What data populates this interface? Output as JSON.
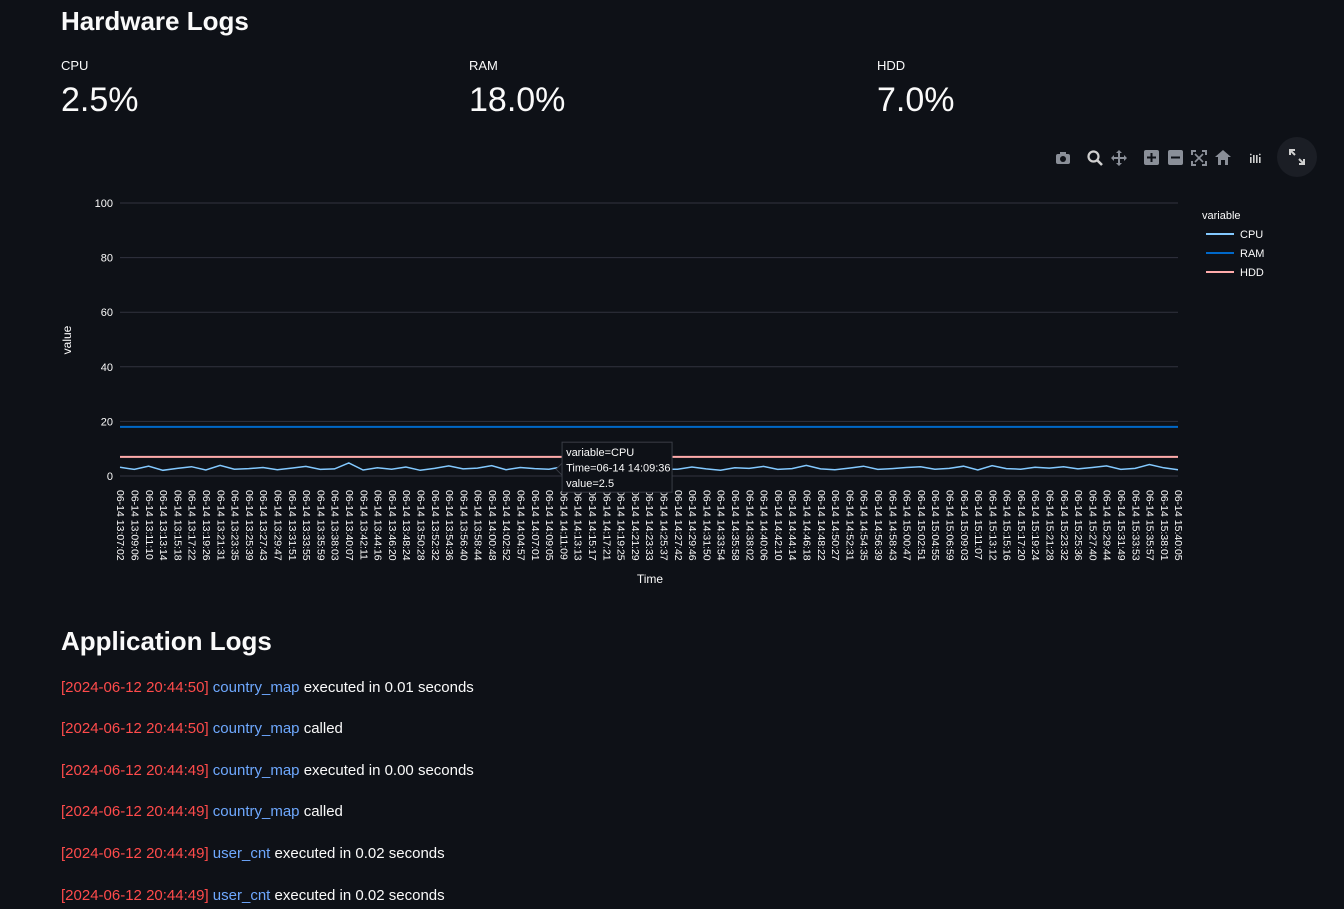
{
  "hardware": {
    "title": "Hardware Logs",
    "metrics": [
      {
        "label": "CPU",
        "value": "2.5%"
      },
      {
        "label": "RAM",
        "value": "18.0%"
      },
      {
        "label": "HDD",
        "value": "7.0%"
      }
    ]
  },
  "toolbar": {
    "icons": [
      "camera-icon",
      "zoom-icon",
      "pan-icon",
      "zoom-in-icon",
      "zoom-out-icon",
      "autoscale-icon",
      "home-icon",
      "plotly-logo-icon"
    ],
    "fullscreen_icon": "expand-icon"
  },
  "chart_data": {
    "type": "line",
    "xlabel": "Time",
    "ylabel": "value",
    "ylim": [
      0,
      100
    ],
    "yticks": [
      0,
      20,
      40,
      60,
      80,
      100
    ],
    "grid": true,
    "legend": {
      "title": "variable",
      "position": "top-right",
      "entries": [
        "CPU",
        "RAM",
        "HDD"
      ]
    },
    "x_ticks": [
      "06-14 13:07:02",
      "06-14 13:09:06",
      "06-14 13:11:10",
      "06-14 13:13:14",
      "06-14 13:15:18",
      "06-14 13:17:22",
      "06-14 13:19:26",
      "06-14 13:21:31",
      "06-14 13:23:35",
      "06-14 13:25:39",
      "06-14 13:27:43",
      "06-14 13:29:47",
      "06-14 13:31:51",
      "06-14 13:33:55",
      "06-14 13:35:59",
      "06-14 13:38:03",
      "06-14 13:40:07",
      "06-14 13:42:11",
      "06-14 13:44:16",
      "06-14 13:46:20",
      "06-14 13:48:24",
      "06-14 13:50:28",
      "06-14 13:52:32",
      "06-14 13:54:36",
      "06-14 13:56:40",
      "06-14 13:58:44",
      "06-14 14:00:48",
      "06-14 14:02:52",
      "06-14 14:04:57",
      "06-14 14:07:01",
      "06-14 14:09:05",
      "06-14 14:11:09",
      "06-14 14:13:13",
      "06-14 14:15:17",
      "06-14 14:17:21",
      "06-14 14:19:25",
      "06-14 14:21:29",
      "06-14 14:23:33",
      "06-14 14:25:37",
      "06-14 14:27:42",
      "06-14 14:29:46",
      "06-14 14:31:50",
      "06-14 14:33:54",
      "06-14 14:35:58",
      "06-14 14:38:02",
      "06-14 14:40:06",
      "06-14 14:42:10",
      "06-14 14:44:14",
      "06-14 14:46:18",
      "06-14 14:48:22",
      "06-14 14:50:27",
      "06-14 14:52:31",
      "06-14 14:54:35",
      "06-14 14:56:39",
      "06-14 14:58:43",
      "06-14 15:00:47",
      "06-14 15:02:51",
      "06-14 15:04:55",
      "06-14 15:06:59",
      "06-14 15:09:03",
      "06-14 15:11:07",
      "06-14 15:13:12",
      "06-14 15:15:16",
      "06-14 15:17:20",
      "06-14 15:19:24",
      "06-14 15:21:28",
      "06-14 15:23:32",
      "06-14 15:25:36",
      "06-14 15:27:40",
      "06-14 15:29:44",
      "06-14 15:31:49",
      "06-14 15:33:53",
      "06-14 15:35:57",
      "06-14 15:38:01",
      "06-14 15:40:05"
    ],
    "series": [
      {
        "name": "CPU",
        "color": "#83c9ff",
        "values": [
          3.2,
          2.4,
          3.6,
          2.1,
          2.8,
          3.4,
          2.2,
          3.9,
          2.5,
          2.7,
          3.1,
          2.3,
          2.9,
          3.5,
          2.4,
          2.6,
          4.8,
          2.2,
          3.0,
          2.5,
          3.3,
          2.1,
          2.8,
          3.7,
          2.6,
          2.9,
          3.8,
          2.3,
          3.1,
          2.7,
          2.5,
          3.4,
          2.2,
          3.6,
          2.8,
          2.4,
          6.2,
          2.9,
          2.5,
          2.5,
          3.3,
          2.6,
          2.1,
          3.0,
          2.8,
          3.5,
          2.4,
          2.7,
          3.9,
          2.6,
          2.3,
          2.9,
          3.6,
          2.4,
          2.7,
          3.1,
          3.4,
          2.5,
          2.8,
          3.6,
          2.2,
          3.8,
          2.7,
          2.5,
          3.2,
          2.9,
          3.4,
          2.6,
          3.1,
          3.7,
          2.4,
          2.8,
          4.2,
          3.0,
          2.3
        ]
      },
      {
        "name": "RAM",
        "color": "#0068c9",
        "values": [
          18.0,
          18.0,
          18.0,
          18.0,
          18.0,
          18.0,
          18.0,
          18.0,
          18.0,
          18.0,
          18.0,
          18.0,
          18.0,
          18.0,
          18.0,
          18.0,
          18.0,
          18.0,
          18.0,
          18.0,
          18.0,
          18.0,
          18.0,
          18.0,
          18.0,
          18.0,
          18.0,
          18.0,
          18.0,
          18.0,
          18.0,
          18.0,
          18.0,
          18.0,
          18.0,
          18.0,
          18.0,
          18.0,
          18.0,
          18.0,
          18.0,
          18.0,
          18.0,
          18.0,
          18.0,
          18.0,
          18.0,
          18.0,
          18.0,
          18.0,
          18.0,
          18.0,
          18.0,
          18.0,
          18.0,
          18.0,
          18.0,
          18.0,
          18.0,
          18.0,
          18.0,
          18.0,
          18.0,
          18.0,
          18.0,
          18.0,
          18.0,
          18.0,
          18.0,
          18.0,
          18.0,
          18.0,
          18.0,
          18.0,
          18.0
        ]
      },
      {
        "name": "HDD",
        "color": "#ffabab",
        "values": [
          7.0,
          7.0,
          7.0,
          7.0,
          7.0,
          7.0,
          7.0,
          7.0,
          7.0,
          7.0,
          7.0,
          7.0,
          7.0,
          7.0,
          7.0,
          7.0,
          7.0,
          7.0,
          7.0,
          7.0,
          7.0,
          7.0,
          7.0,
          7.0,
          7.0,
          7.0,
          7.0,
          7.0,
          7.0,
          7.0,
          7.0,
          7.0,
          7.0,
          7.0,
          7.0,
          7.0,
          7.0,
          7.0,
          7.0,
          7.0,
          7.0,
          7.0,
          7.0,
          7.0,
          7.0,
          7.0,
          7.0,
          7.0,
          7.0,
          7.0,
          7.0,
          7.0,
          7.0,
          7.0,
          7.0,
          7.0,
          7.0,
          7.0,
          7.0,
          7.0,
          7.0,
          7.0,
          7.0,
          7.0,
          7.0,
          7.0,
          7.0,
          7.0,
          7.0,
          7.0,
          7.0,
          7.0,
          7.0,
          7.0,
          7.0
        ]
      }
    ],
    "tooltip": {
      "lines": [
        "variable=CPU",
        "Time=06-14 14:09:36",
        "value=2.5"
      ],
      "series": "CPU",
      "x_index": 30.5,
      "value": 2.5
    }
  },
  "app_logs": {
    "title": "Application Logs",
    "entries": [
      {
        "ts": "[2024-06-12 20:44:50]",
        "fn": "country_map",
        "msg": "executed in 0.01 seconds"
      },
      {
        "ts": "[2024-06-12 20:44:50]",
        "fn": "country_map",
        "msg": "called"
      },
      {
        "ts": "[2024-06-12 20:44:49]",
        "fn": "country_map",
        "msg": "executed in 0.00 seconds"
      },
      {
        "ts": "[2024-06-12 20:44:49]",
        "fn": "country_map",
        "msg": "called"
      },
      {
        "ts": "[2024-06-12 20:44:49]",
        "fn": "user_cnt",
        "msg": "executed in 0.02 seconds"
      },
      {
        "ts": "[2024-06-12 20:44:49]",
        "fn": "user_cnt",
        "msg": "executed in 0.02 seconds"
      }
    ]
  }
}
